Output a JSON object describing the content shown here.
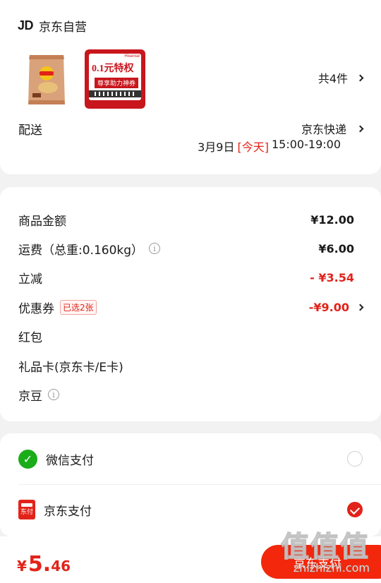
{
  "shop": {
    "logo": "JD",
    "name": "京东自营",
    "item_count": "共4件"
  },
  "coupon_image": {
    "brand": "Hisense",
    "headline": "0.1元特权",
    "subline": "尊享助力神券"
  },
  "delivery": {
    "label": "配送",
    "carrier": "京东快递",
    "date": "3月9日",
    "today": "[今天]",
    "time": "15:00-19:00"
  },
  "price_rows": [
    {
      "label": "商品金额",
      "value": "¥12.00"
    },
    {
      "label": "运费（总重:0.160kg）",
      "value": "¥6.00"
    },
    {
      "label": "立减",
      "value": "- ¥3.54"
    },
    {
      "label": "优惠券",
      "badge": "已选2张",
      "value": "-¥9.00"
    },
    {
      "label": "红包",
      "value": ""
    },
    {
      "label": "礼品卡(京东卡/E卡)",
      "value": ""
    },
    {
      "label": "京豆",
      "value": ""
    }
  ],
  "payment": {
    "wechat": {
      "label": "微信支付",
      "selected": false
    },
    "jdpay": {
      "label": "京东支付",
      "icon_text": "东付",
      "selected": true
    }
  },
  "bottom": {
    "currency": "¥",
    "total_int": "5.",
    "total_dec": "46",
    "pay_button": "京东支付"
  },
  "watermark": {
    "glyphs": "值值值",
    "site": "zhizhizhi.com"
  },
  "colors": {
    "accent": "#e2231a",
    "wechat": "#1aad19"
  }
}
